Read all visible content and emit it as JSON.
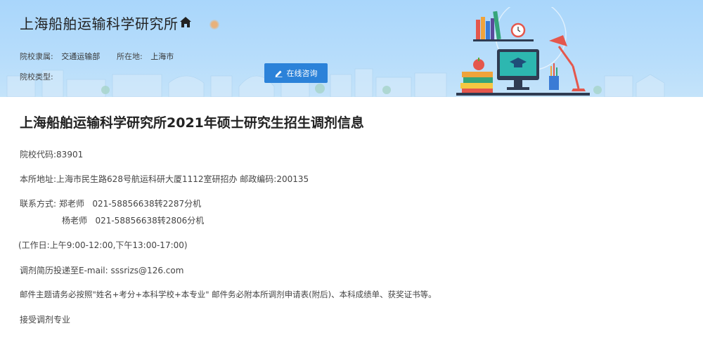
{
  "header": {
    "school_name": "上海船舶运输科学研究所",
    "affiliation_label": "院校隶属:",
    "affiliation_value": "交通运输部",
    "location_label": "所在地:",
    "location_value": "上海市",
    "type_label": "院校类型:",
    "type_value": "",
    "consult_button": "在线咨询",
    "colors": {
      "banner": "#a9d6fb",
      "button": "#2b82d9"
    }
  },
  "article": {
    "title": "上海船舶运输科学研究所2021年硕士研究生招生调剂信息",
    "code_line": "院校代码:83901",
    "address_line": "本所地址:上海市民生路628号航运科研大厦1112室研招办 邮政编码:200135",
    "contact_label": "联系方式:",
    "contact_1": "郑老师   021-58856638转2287分机",
    "contact_2": "杨老师   021-58856638转2806分机",
    "workday_line": "(工作日:上午9:00-12:00,下午13:00-17:00)",
    "email_line": "调剂简历投递至E-mail:  sssrizs@126.com",
    "subject_line": "邮件主题请务必按照\"姓名+考分+本科学校+本专业\" 邮件务必附本所调剂申请表(附后)、本科成绩单、获奖证书等。",
    "majors_line": "接受调剂专业"
  }
}
